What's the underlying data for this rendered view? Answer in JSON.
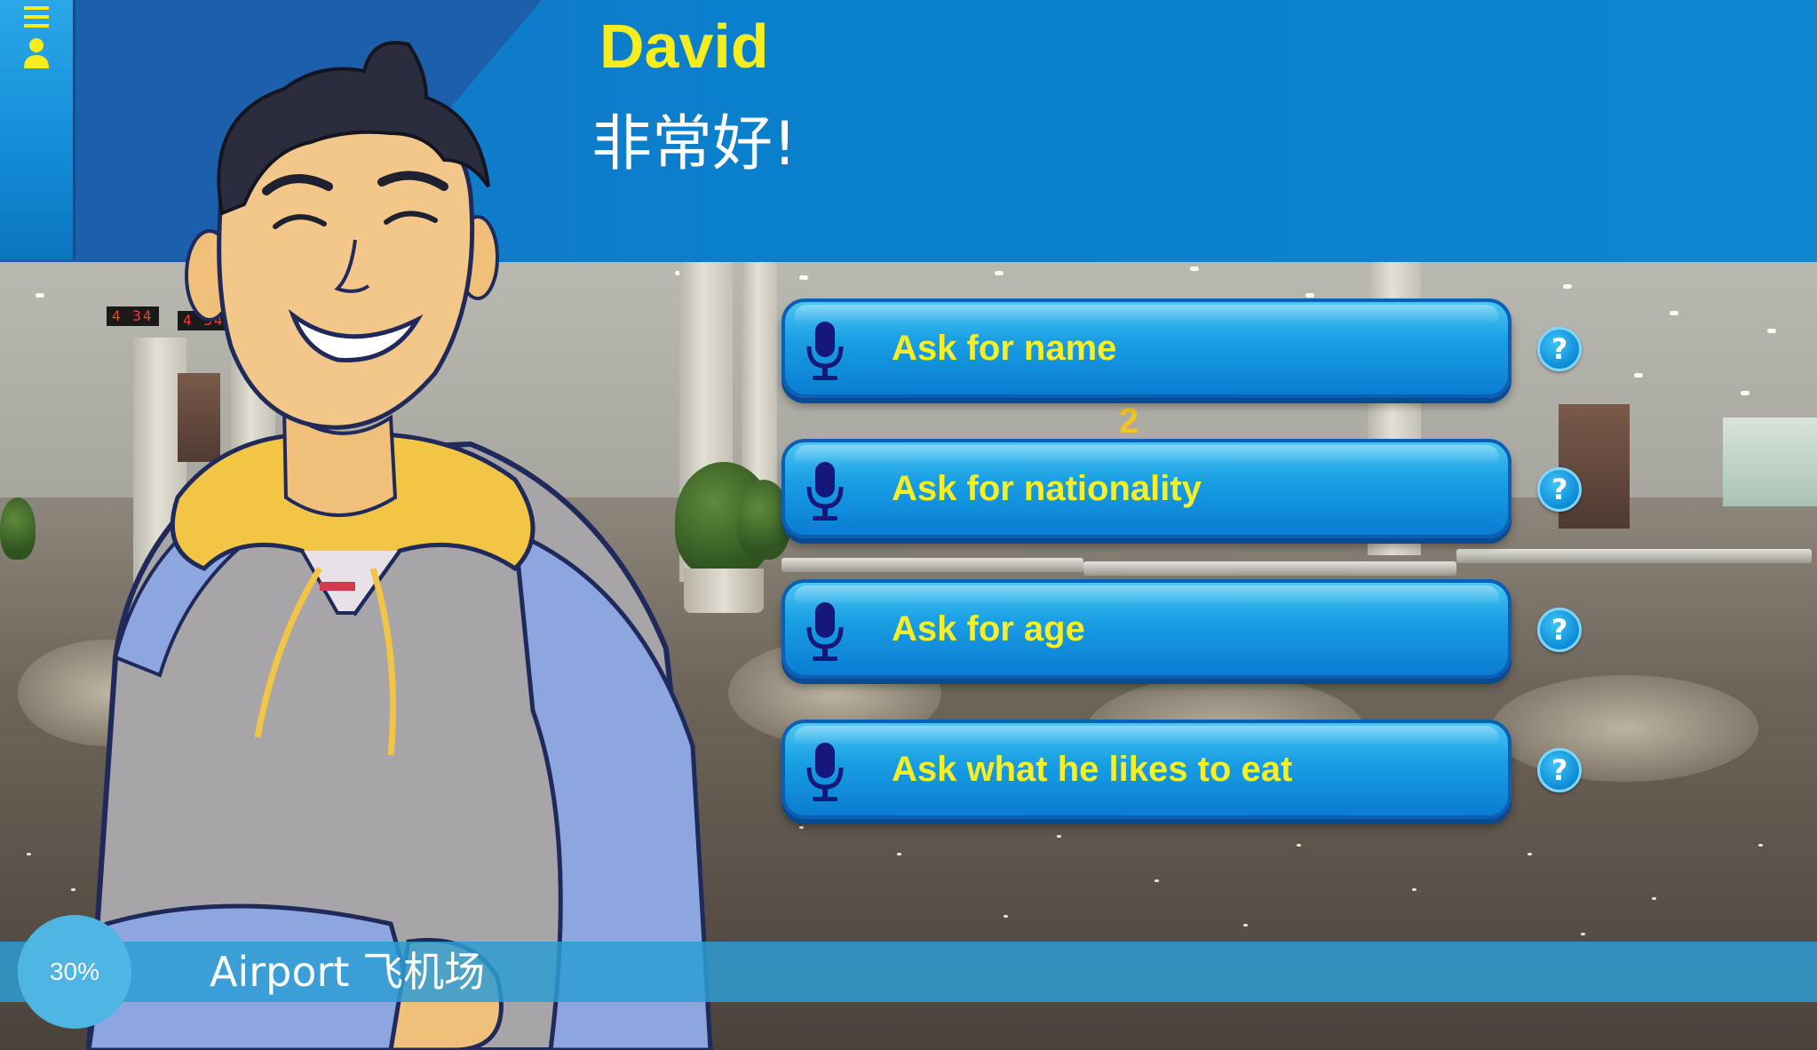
{
  "menu": {
    "icon": "menu-profile-icon"
  },
  "dialogue": {
    "speaker": "David",
    "line": "非常好!"
  },
  "options": [
    {
      "label": "Ask for name",
      "icon": "microphone-icon",
      "help": "?"
    },
    {
      "label": "Ask for nationality",
      "icon": "microphone-icon",
      "help": "?"
    },
    {
      "label": "Ask for age",
      "icon": "microphone-icon",
      "help": "?"
    },
    {
      "label": "Ask what he likes to eat",
      "icon": "microphone-icon",
      "help": "?"
    }
  ],
  "progress": {
    "value": 0.3,
    "text": "30%"
  },
  "location": "Airport 飞机场",
  "scene": {
    "clock_text": "4 34",
    "clock_text_2": "4 34",
    "gate_number": "2"
  },
  "colors": {
    "header_blue": "#0a7fcc",
    "header_dark": "#1c5fab",
    "name_yellow": "#f7ec1e",
    "option_label_yellow": "#f6ee27",
    "bottom_bar": "#2e9cd4",
    "progress_circle": "#4fb6e4"
  }
}
